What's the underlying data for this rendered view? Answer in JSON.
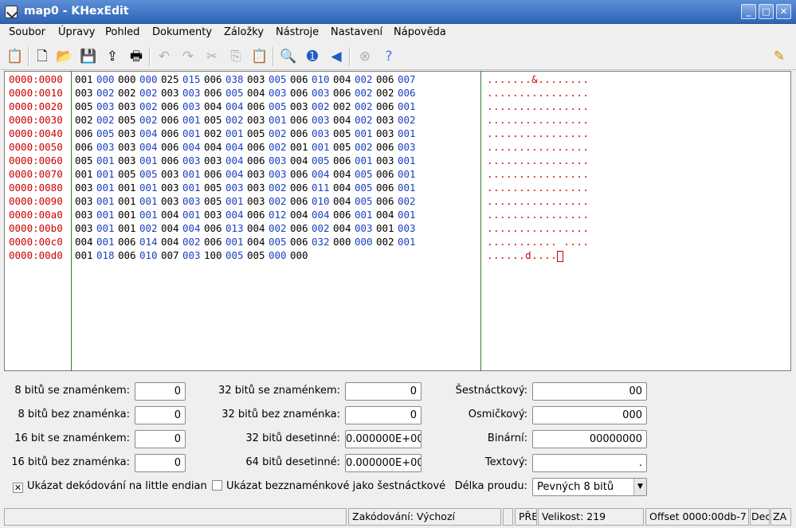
{
  "window": {
    "title": "map0 - KHexEdit"
  },
  "menu": [
    "Soubor",
    "Úpravy",
    "Pohled",
    "Dokumenty",
    "Záložky",
    "Nástroje",
    "Nastavení",
    "Nápověda"
  ],
  "toolbar_icons": [
    "app-icon",
    "new-icon",
    "open-icon",
    "save-icon",
    "export-icon",
    "print-icon",
    "undo-icon",
    "redo-icon",
    "cut-icon",
    "copy-icon",
    "paste-icon",
    "find-icon",
    "forward-icon",
    "back-icon",
    "stop-icon",
    "help-icon",
    "edit-icon"
  ],
  "hex": {
    "offsets": [
      "0000:0000",
      "0000:0010",
      "0000:0020",
      "0000:0030",
      "0000:0040",
      "0000:0050",
      "0000:0060",
      "0000:0070",
      "0000:0080",
      "0000:0090",
      "0000:00a0",
      "0000:00b0",
      "0000:00c0",
      "0000:00d0"
    ],
    "rows": [
      [
        "001",
        "000",
        "000",
        "000",
        "025",
        "015",
        "006",
        "038",
        "003",
        "005",
        "006",
        "010",
        "004",
        "002",
        "006",
        "007"
      ],
      [
        "003",
        "002",
        "002",
        "002",
        "003",
        "003",
        "006",
        "005",
        "004",
        "003",
        "006",
        "003",
        "006",
        "002",
        "002",
        "006"
      ],
      [
        "005",
        "003",
        "003",
        "002",
        "006",
        "003",
        "004",
        "004",
        "006",
        "005",
        "003",
        "002",
        "002",
        "002",
        "006",
        "001"
      ],
      [
        "002",
        "002",
        "005",
        "002",
        "006",
        "001",
        "005",
        "002",
        "003",
        "001",
        "006",
        "003",
        "004",
        "002",
        "003",
        "002"
      ],
      [
        "006",
        "005",
        "003",
        "004",
        "006",
        "001",
        "002",
        "001",
        "005",
        "002",
        "006",
        "003",
        "005",
        "001",
        "003",
        "001"
      ],
      [
        "006",
        "003",
        "003",
        "004",
        "006",
        "004",
        "004",
        "004",
        "006",
        "002",
        "001",
        "001",
        "005",
        "002",
        "006",
        "003"
      ],
      [
        "005",
        "001",
        "003",
        "001",
        "006",
        "003",
        "003",
        "004",
        "006",
        "003",
        "004",
        "005",
        "006",
        "001",
        "003",
        "001"
      ],
      [
        "001",
        "001",
        "005",
        "005",
        "003",
        "001",
        "006",
        "004",
        "003",
        "003",
        "006",
        "004",
        "004",
        "005",
        "006",
        "001"
      ],
      [
        "003",
        "001",
        "001",
        "001",
        "003",
        "001",
        "005",
        "003",
        "003",
        "002",
        "006",
        "011",
        "004",
        "005",
        "006",
        "001"
      ],
      [
        "003",
        "001",
        "001",
        "001",
        "003",
        "003",
        "005",
        "001",
        "003",
        "002",
        "006",
        "010",
        "004",
        "005",
        "006",
        "002"
      ],
      [
        "003",
        "001",
        "001",
        "001",
        "004",
        "001",
        "003",
        "004",
        "006",
        "012",
        "004",
        "004",
        "006",
        "001",
        "004",
        "001"
      ],
      [
        "003",
        "001",
        "001",
        "002",
        "004",
        "004",
        "006",
        "013",
        "004",
        "002",
        "006",
        "002",
        "004",
        "003",
        "001",
        "003"
      ],
      [
        "004",
        "001",
        "006",
        "014",
        "004",
        "002",
        "006",
        "001",
        "004",
        "005",
        "006",
        "032",
        "000",
        "000",
        "002",
        "001"
      ],
      [
        "001",
        "018",
        "006",
        "010",
        "007",
        "003",
        "100",
        "005",
        "005",
        "000",
        "000"
      ]
    ],
    "chars": [
      ".......&........",
      "................",
      "................",
      "................",
      "................",
      "................",
      "................",
      "................",
      "................",
      "................",
      "................",
      "................",
      "........... ....",
      "......d...."
    ]
  },
  "decoder": {
    "labels": {
      "s8": "8 bitů se znaménkem:",
      "u8": "8 bitů bez znaménka:",
      "s16": "16 bit se znaménkem:",
      "u16": "16 bitů bez znaménka:",
      "s32": "32 bitů se znaménkem:",
      "u32": "32 bitů bez znaménka:",
      "f32": "32 bitů desetinné:",
      "f64": "64 bitů desetinné:",
      "hex": "Šestnáctkový:",
      "oct": "Osmičkový:",
      "bin": "Binární:",
      "txt": "Textový:"
    },
    "values": {
      "s8": "0",
      "u8": "0",
      "s16": "0",
      "u16": "0",
      "s32": "0",
      "u32": "0",
      "f32": "0.000000E+00",
      "f64": "0.000000E+00",
      "hex": "00",
      "oct": "000",
      "bin": "00000000",
      "txt": "."
    },
    "little_endian_label": "Ukázat dekódování na little endian",
    "little_endian_checked": "✕",
    "unsigned_hex_label": "Ukázat bezznaménkové jako šestnáctkové",
    "stream_length_label": "Délka proudu:",
    "stream_length_value": "Pevných 8 bitů"
  },
  "status": {
    "encoding": "Zakódování: Výchozí",
    "mode": "PŘE",
    "size": "Velikost: 219",
    "offset": "Offset 0000:00db-7",
    "dec": "Dec",
    "za": "ZA"
  }
}
